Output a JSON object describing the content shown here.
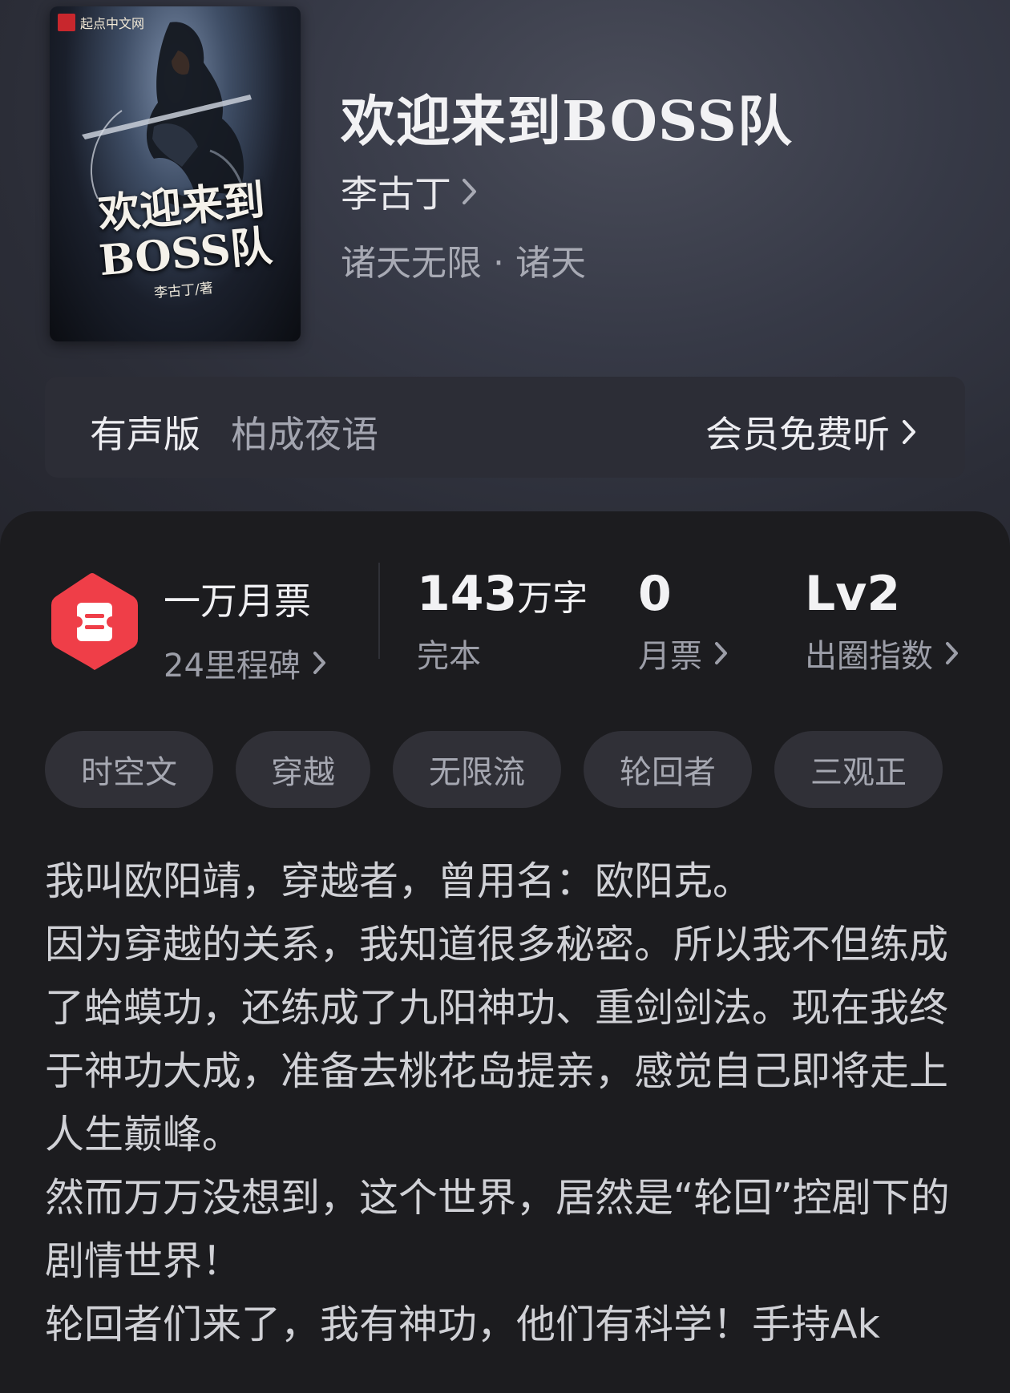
{
  "book": {
    "title": "欢迎来到BOSS队",
    "author": "李古丁",
    "genre": "诸天无限 · 诸天"
  },
  "cover": {
    "brand": "起点中文网",
    "title_line1": "欢迎来到",
    "title_line2": "BOSS队",
    "author": "李古丁/著"
  },
  "audio": {
    "label": "有声版",
    "narrator": "柏成夜语",
    "cta": "会员免费听"
  },
  "stats": {
    "milestone_title": "一万月票",
    "milestone_sub": "24里程碑",
    "word_count_num": "143",
    "word_count_unit": "万字",
    "status": "完本",
    "monthly_votes": "0",
    "monthly_votes_label": "月票",
    "level": "Lv2",
    "level_label": "出圈指数"
  },
  "tags": [
    "时空文",
    "穿越",
    "无限流",
    "轮回者",
    "三观正"
  ],
  "description": [
    "我叫欧阳靖，穿越者，曾用名：欧阳克。",
    "因为穿越的关系，我知道很多秘密。所以我不但练成了蛤蟆功，还练成了九阳神功、重剑剑法。现在我终于神功大成，准备去桃花岛提亲，感觉自己即将走上人生巅峰。",
    "然而万万没想到，这个世界，居然是“轮回”控剧下的剧情世界！",
    "轮回者们来了，我有神功，他们有科学！手持Ak"
  ],
  "colors": {
    "accent_red": "#ef3e48",
    "background": "#1c1c1f",
    "hero_background": "#30323d"
  }
}
